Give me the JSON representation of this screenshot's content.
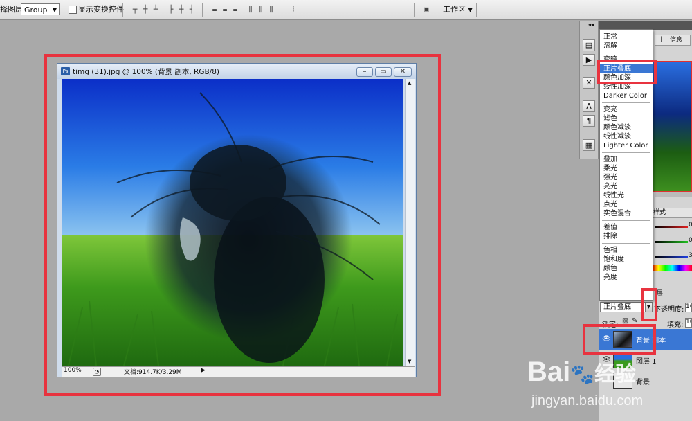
{
  "options_bar": {
    "auto_select_label": "择图层",
    "auto_select_value": "Group",
    "show_transform_label": "显示变换控件",
    "workspace_label": "工作区"
  },
  "document": {
    "title": "timg (31).jpg @ 100% (背景 副本, RGB/8)",
    "zoom": "100%",
    "file_info": "文档:914.7K/3.29M"
  },
  "blend_menu": {
    "groups": [
      [
        "正常",
        "溶解"
      ],
      [
        "变暗",
        "正片叠底",
        "颜色加深",
        "线性加深",
        "Darker Color"
      ],
      [
        "变亮",
        "滤色",
        "颜色减淡",
        "线性减淡",
        "Lighter Color"
      ],
      [
        "叠加",
        "柔光",
        "强光",
        "亮光",
        "线性光",
        "点光",
        "实色混合"
      ],
      [
        "差值",
        "排除"
      ],
      [
        "色相",
        "饱和度",
        "颜色",
        "亮度"
      ]
    ],
    "selected": "正片叠底"
  },
  "panels": {
    "tab_partial": "图",
    "tab_info": "信息",
    "tab_styles": "样式",
    "tab_layers_partial": "层",
    "slider_values": [
      "0",
      "0",
      "3"
    ],
    "blend_mode_value": "正片叠底",
    "opacity_label": "不透明度:",
    "opacity_value": "10",
    "lock_label": "锁定:",
    "fill_label": "填充:",
    "fill_value": "10"
  },
  "layers": [
    {
      "name": "背景 副本",
      "selected": true
    },
    {
      "name": "图层 1",
      "selected": false
    },
    {
      "name": "背景",
      "selected": false
    }
  ],
  "watermark": {
    "logo_text": "Bai",
    "logo_suffix": "经验",
    "url": "jingyan.baidu.com"
  },
  "colors": {
    "highlight": "#3a77d4",
    "red_box": "#e8333f",
    "workspace_bg": "#a9a9a9"
  }
}
